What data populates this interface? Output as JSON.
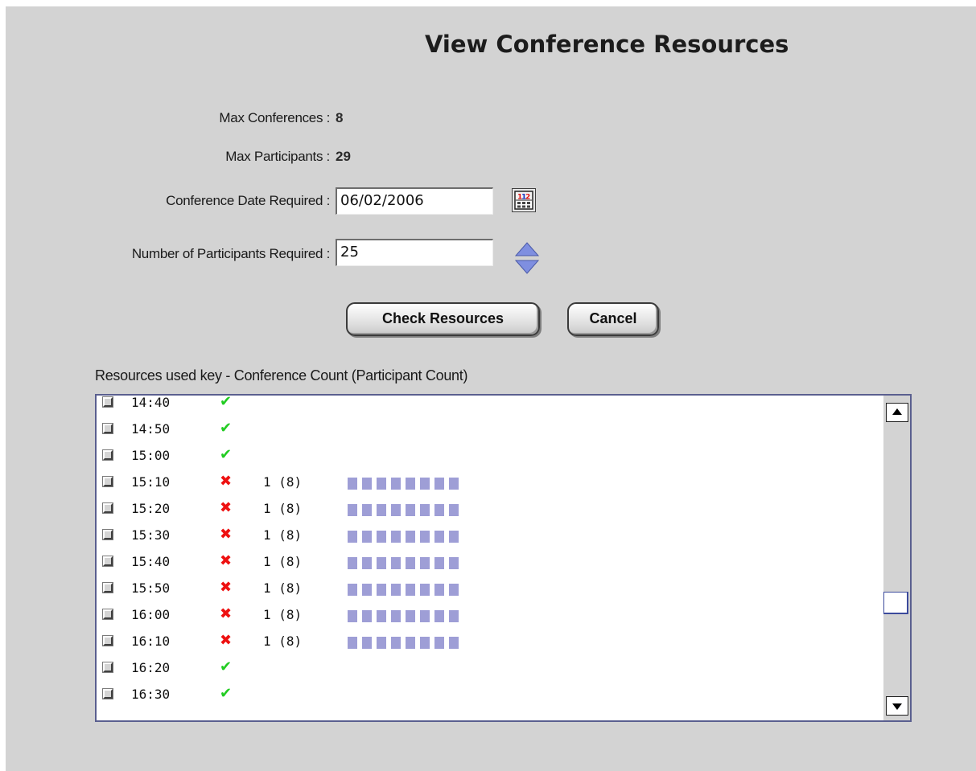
{
  "page_title": "View Conference Resources",
  "max_conferences": {
    "label": "Max Conferences :",
    "value": "8"
  },
  "max_participants": {
    "label": "Max Participants :",
    "value": "29"
  },
  "conference_date": {
    "label": "Conference Date Required :",
    "value": "06/02/2006"
  },
  "participants_required": {
    "label": "Number of Participants Required :",
    "value": "25"
  },
  "buttons": {
    "check_resources": "Check Resources",
    "cancel": "Cancel"
  },
  "resources_key_label": "Resources used key - Conference Count (Participant Count)",
  "icons": {
    "calendar": "calendar-icon",
    "spinner": "up-down-spinner-icon",
    "available": "check-mark-icon",
    "unavailable": "cross-icon",
    "scroll_up": "scroll-up-arrow-icon",
    "scroll_down": "scroll-down-arrow-icon"
  },
  "colors": {
    "available": "#22cc22",
    "unavailable": "#ee1111",
    "usage_block": "#9e9ed6",
    "panel_background": "#d3d3d3"
  },
  "time_slots": [
    {
      "time": "14:40",
      "available": true,
      "count": "",
      "usage_blocks": 0
    },
    {
      "time": "14:50",
      "available": true,
      "count": "",
      "usage_blocks": 0
    },
    {
      "time": "15:00",
      "available": true,
      "count": "",
      "usage_blocks": 0
    },
    {
      "time": "15:10",
      "available": false,
      "count": "1 (8)",
      "usage_blocks": 8
    },
    {
      "time": "15:20",
      "available": false,
      "count": "1 (8)",
      "usage_blocks": 8
    },
    {
      "time": "15:30",
      "available": false,
      "count": "1 (8)",
      "usage_blocks": 8
    },
    {
      "time": "15:40",
      "available": false,
      "count": "1 (8)",
      "usage_blocks": 8
    },
    {
      "time": "15:50",
      "available": false,
      "count": "1 (8)",
      "usage_blocks": 8
    },
    {
      "time": "16:00",
      "available": false,
      "count": "1 (8)",
      "usage_blocks": 8
    },
    {
      "time": "16:10",
      "available": false,
      "count": "1 (8)",
      "usage_blocks": 8
    },
    {
      "time": "16:20",
      "available": true,
      "count": "",
      "usage_blocks": 0
    },
    {
      "time": "16:30",
      "available": true,
      "count": "",
      "usage_blocks": 0
    }
  ]
}
